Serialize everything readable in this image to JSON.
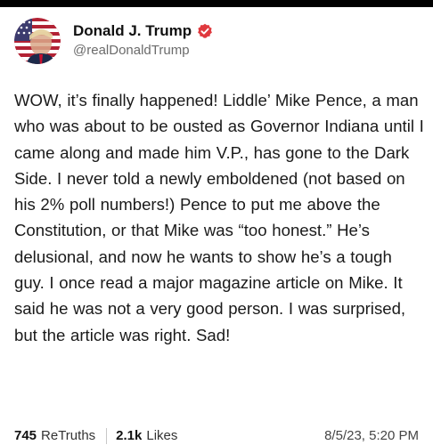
{
  "post": {
    "author": {
      "display_name": "Donald J. Trump",
      "handle": "@realDonaldTrump",
      "verified_badge_color": "#e0393e",
      "avatar_icon": "flag-portrait-avatar"
    },
    "text": "WOW, it’s finally happened! Liddle’ Mike Pence, a man who was about to be ousted as Governor Indiana until I came along and made him V.P., has gone to the Dark Side. I never told a newly emboldened (not based on his 2% poll numbers!) Pence to put me above the Constitution, or that Mike was “too honest.” He’s delusional, and now he wants to show he’s a tough guy. I once read a major magazine article on Mike. It said he was not a very good person. I was surprised, but the article was right. Sad!",
    "stats": {
      "retruths_count": "745",
      "retruths_label": "ReTruths",
      "likes_count": "2.1k",
      "likes_label": "Likes"
    },
    "timestamp": "8/5/23, 5:20 PM"
  }
}
